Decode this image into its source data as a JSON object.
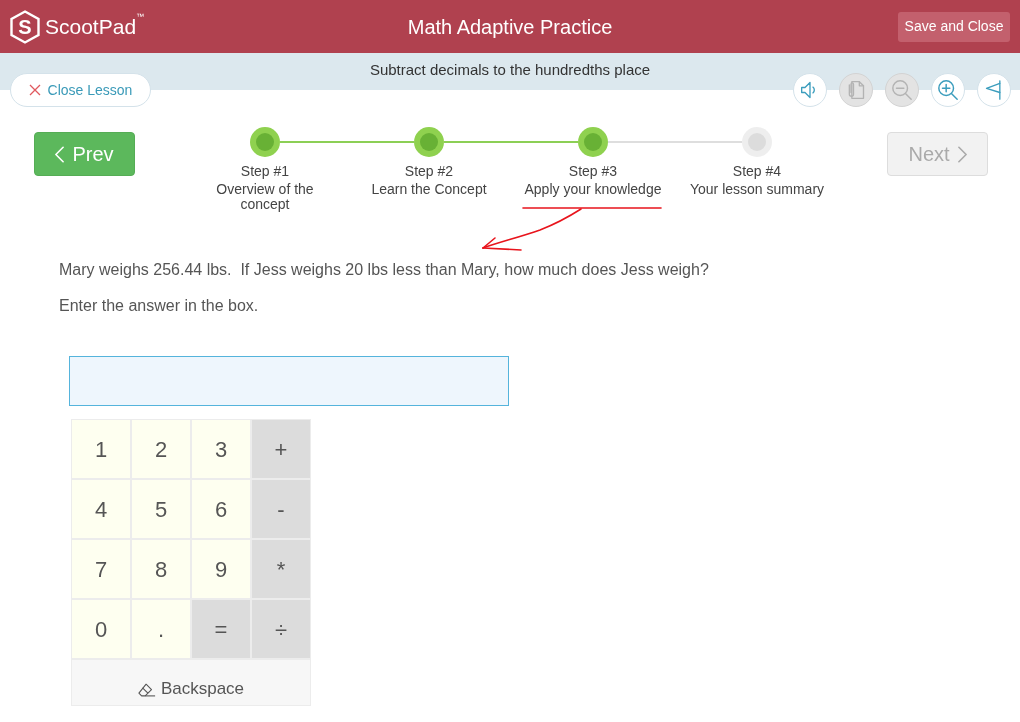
{
  "header": {
    "logo": {
      "mark": "S",
      "name": "ScootPad",
      "trademark": "™"
    },
    "title": "Math Adaptive Practice",
    "save_button": "Save and Close"
  },
  "lesson_bar": {
    "topic": "Subtract decimals to the hundredths place",
    "close_button": "Close Lesson",
    "tools": [
      {
        "kind": "audio",
        "disabled": false
      },
      {
        "kind": "notes",
        "disabled": true
      },
      {
        "kind": "zoom_out",
        "disabled": true
      },
      {
        "kind": "zoom_in",
        "disabled": false
      },
      {
        "kind": "flag",
        "disabled": false
      }
    ]
  },
  "navigation": {
    "prev_button": {
      "label": "Prev",
      "disabled": false
    },
    "steps": [
      {
        "number": "Step #1",
        "title": "Overview of the concept",
        "reached": true
      },
      {
        "number": "Step #2",
        "title": "Learn the Concept",
        "reached": true
      },
      {
        "number": "Step #3",
        "title": "Apply your knowledge",
        "reached": true
      },
      {
        "number": "Step #4",
        "title": "Your lesson summary",
        "reached": false
      }
    ],
    "next_button": {
      "label": "Next",
      "disabled": true
    }
  },
  "question": {
    "prompt": "Mary weighs 256.44 lbs.  If Jess weighs 20 lbs less than Mary, how much does Jess weigh?",
    "instruction": "Enter the answer in the box."
  },
  "keypad": {
    "keys": [
      {
        "label": "1",
        "kind": "number"
      },
      {
        "label": "2",
        "kind": "number"
      },
      {
        "label": "3",
        "kind": "number"
      },
      {
        "label": "+",
        "kind": "operator"
      },
      {
        "label": "4",
        "kind": "number"
      },
      {
        "label": "5",
        "kind": "number"
      },
      {
        "label": "6",
        "kind": "number"
      },
      {
        "label": "-",
        "kind": "operator"
      },
      {
        "label": "7",
        "kind": "number"
      },
      {
        "label": "8",
        "kind": "number"
      },
      {
        "label": "9",
        "kind": "number"
      },
      {
        "label": "*",
        "kind": "operator"
      },
      {
        "label": "0",
        "kind": "number"
      },
      {
        "label": ".",
        "kind": "number"
      },
      {
        "label": "=",
        "kind": "operator"
      },
      {
        "label": "÷",
        "kind": "operator"
      }
    ],
    "backspace": "Backspace"
  }
}
